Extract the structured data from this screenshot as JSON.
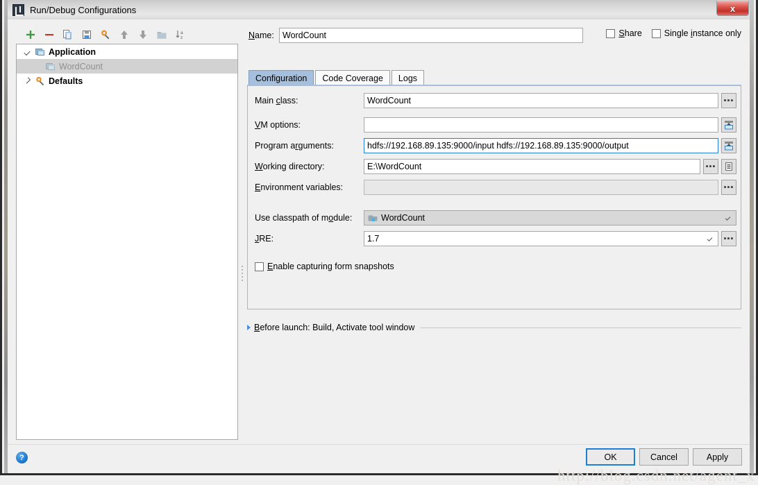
{
  "window": {
    "title": "Run/Debug Configurations",
    "app_icon": "intellij-idea-icon",
    "close_label": "x"
  },
  "toolbar": {
    "buttons": [
      {
        "name": "add-configuration-button",
        "icon": "plus-icon",
        "tooltip": "Add New Configuration"
      },
      {
        "name": "remove-configuration-button",
        "icon": "minus-icon",
        "tooltip": "Remove Configuration"
      },
      {
        "name": "copy-configuration-button",
        "icon": "copy-icon",
        "tooltip": "Copy Configuration"
      },
      {
        "name": "save-configuration-button",
        "icon": "save-icon",
        "tooltip": "Save Configuration"
      },
      {
        "name": "edit-defaults-button",
        "icon": "wrench-icon",
        "tooltip": "Edit Defaults"
      },
      {
        "name": "move-up-button",
        "icon": "arrow-up-icon",
        "tooltip": "Move Up"
      },
      {
        "name": "move-down-button",
        "icon": "arrow-down-icon",
        "tooltip": "Move Down"
      },
      {
        "name": "create-folder-button",
        "icon": "folder-icon",
        "tooltip": "Create New Folder"
      },
      {
        "name": "sort-alphabetically-button",
        "icon": "sort-az-icon",
        "tooltip": "Sort Configurations"
      }
    ]
  },
  "tree": {
    "items": [
      {
        "label": "Application",
        "level": 1,
        "expanded": true,
        "bold": true,
        "selected": false,
        "icon": "application-icon"
      },
      {
        "label": "WordCount",
        "level": 2,
        "expanded": null,
        "bold": false,
        "selected": true,
        "icon": "application-icon"
      },
      {
        "label": "Defaults",
        "level": 1,
        "expanded": false,
        "bold": true,
        "selected": false,
        "icon": "wrench-icon"
      }
    ]
  },
  "name_row": {
    "label": "Name:",
    "value": "WordCount",
    "placeholder": ""
  },
  "options": {
    "share": {
      "label": "Share",
      "checked": false
    },
    "single_instance": {
      "label": "Single instance only",
      "checked": false
    }
  },
  "tabs": [
    {
      "label": "Configuration",
      "active": true
    },
    {
      "label": "Code Coverage",
      "active": false
    },
    {
      "label": "Logs",
      "active": false
    }
  ],
  "form": {
    "main_class": {
      "label": "Main class:",
      "value": "WordCount",
      "browse": "..."
    },
    "vm_options": {
      "label": "VM options:",
      "value": "",
      "expand_icon": "expand-macro-icon"
    },
    "program_arguments": {
      "label": "Program arguments:",
      "value": "hdfs://192.168.89.135:9000/input hdfs://192.168.89.135:9000/output",
      "focused": true,
      "expand_icon": "expand-macro-icon"
    },
    "working_directory": {
      "label": "Working directory:",
      "value": "E:\\WordCount",
      "browse": "...",
      "macro_icon": "insert-macro-icon"
    },
    "environment_variables": {
      "label": "Environment variables:",
      "value": "",
      "browse": "...",
      "disabled": true
    },
    "classpath_module": {
      "label": "Use classpath of module:",
      "value": "WordCount",
      "icon": "module-icon"
    },
    "jre": {
      "label": "JRE:",
      "value": "1.7",
      "browse": "..."
    },
    "form_snapshots": {
      "label": "Enable capturing form snapshots",
      "checked": false
    }
  },
  "before_launch": {
    "text": "Before launch: Build, Activate tool window",
    "expanded": false
  },
  "footer": {
    "help": "?",
    "ok": "OK",
    "cancel": "Cancel",
    "apply": "Apply"
  },
  "watermark": {
    "text": "http://blog.csdn.net/agent_x"
  },
  "colors": {
    "accent_blue": "#2a7fd4",
    "tab_active": "#a5bfdd",
    "selection_grey": "#d2d2d2",
    "panel_bg": "#f0f0f0",
    "close_red": "#c2302a",
    "plus_green": "#3f9b3f",
    "minus_red": "#c0392b"
  }
}
